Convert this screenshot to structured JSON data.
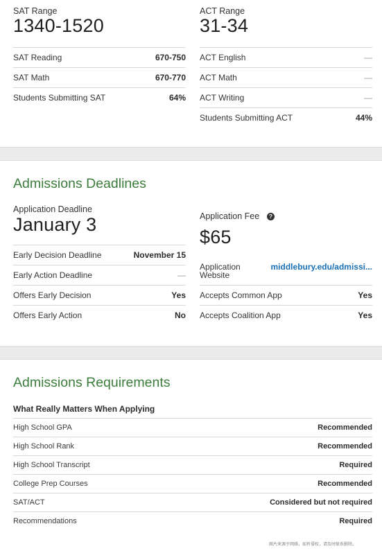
{
  "scores": {
    "sat": {
      "range_label": "SAT Range",
      "range_value": "1340-1520",
      "rows": [
        {
          "label": "SAT Reading",
          "value": "670-750"
        },
        {
          "label": "SAT Math",
          "value": "670-770"
        },
        {
          "label": "Students Submitting SAT",
          "value": "64%"
        }
      ]
    },
    "act": {
      "range_label": "ACT Range",
      "range_value": "31-34",
      "rows": [
        {
          "label": "ACT English",
          "value": "—"
        },
        {
          "label": "ACT Math",
          "value": "—"
        },
        {
          "label": "ACT Writing",
          "value": "—"
        },
        {
          "label": "Students Submitting ACT",
          "value": "44%"
        }
      ]
    }
  },
  "deadlines": {
    "title": "Admissions Deadlines",
    "app_deadline_label": "Application Deadline",
    "app_deadline_value": "January 3",
    "left_rows": [
      {
        "label": "Early Decision Deadline",
        "value": "November 15"
      },
      {
        "label": "Early Action Deadline",
        "value": "—"
      },
      {
        "label": "Offers Early Decision",
        "value": "Yes"
      },
      {
        "label": "Offers Early Action",
        "value": "No"
      }
    ],
    "fee_label": "Application Fee",
    "help_icon": "?",
    "fee_value": "$65",
    "website_label": "Application Website",
    "website_value": "middlebury.edu/admissi...",
    "right_rows": [
      {
        "label": "Accepts Common App",
        "value": "Yes"
      },
      {
        "label": "Accepts Coalition App",
        "value": "Yes"
      }
    ]
  },
  "requirements": {
    "title": "Admissions Requirements",
    "subtitle": "What Really Matters When Applying",
    "rows": [
      {
        "label": "High School GPA",
        "value": "Recommended"
      },
      {
        "label": "High School Rank",
        "value": "Recommended"
      },
      {
        "label": "High School Transcript",
        "value": "Required"
      },
      {
        "label": "College Prep Courses",
        "value": "Recommended"
      },
      {
        "label": "SAT/ACT",
        "value": "Considered but not required"
      },
      {
        "label": "Recommendations",
        "value": "Required"
      }
    ]
  },
  "watermark": "图片来源于网络，如有侵权，请及时联系删除。",
  "colors": {
    "heading_green": "#3c7d3c",
    "link_blue": "#1b6fb3",
    "divider_gray": "#ebebeb"
  }
}
